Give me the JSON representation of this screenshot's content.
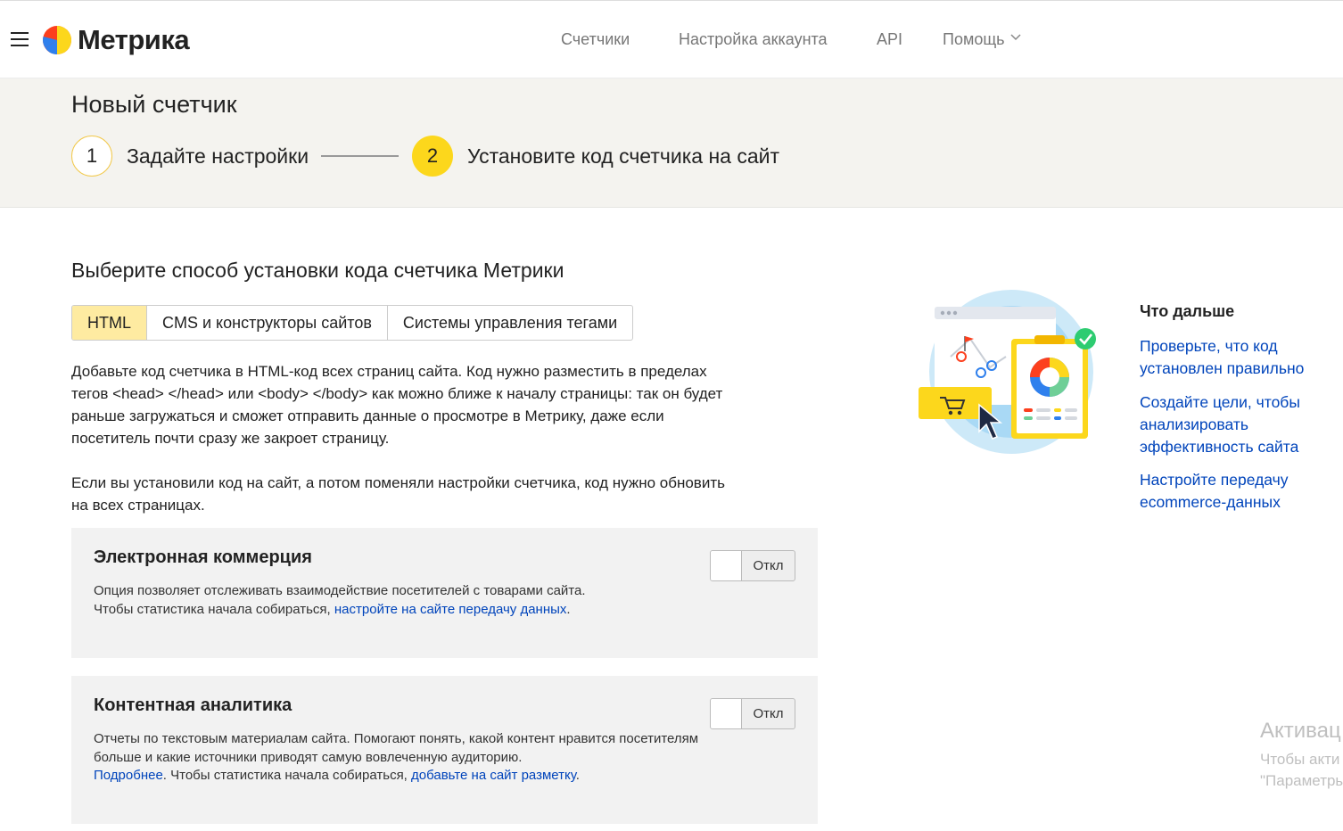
{
  "header": {
    "logo_text": "Метрика",
    "nav": [
      {
        "label": "Счетчики"
      },
      {
        "label": "Настройка аккаунта"
      },
      {
        "label": "API"
      },
      {
        "label": "Помощь"
      }
    ]
  },
  "wizard": {
    "title": "Новый счетчик",
    "steps": [
      {
        "number": "1",
        "label": "Задайте настройки"
      },
      {
        "number": "2",
        "label": "Установите код счетчика на сайт"
      }
    ]
  },
  "install": {
    "title": "Выберите способ установки кода счетчика Метрики",
    "tabs": [
      {
        "label": "HTML",
        "active": true
      },
      {
        "label": "CMS и конструкторы сайтов",
        "active": false
      },
      {
        "label": "Системы управления тегами",
        "active": false
      }
    ],
    "paragraph1": "Добавьте код счетчика в HTML-код всех страниц сайта. Код нужно разместить в пределах тегов <head> </head> или <body> </body> как можно ближе к началу страницы: так он будет раньше загружаться и сможет отправить данные о просмотре в Метрику, даже если посетитель почти сразу же закроет страницу.",
    "paragraph2": "Если вы установили код на сайт, а потом поменяли настройки счетчика, код нужно обновить на всех страницах."
  },
  "ecommerce": {
    "title": "Электронная коммерция",
    "text1": "Опция позволяет отслеживать взаимодействие посетителей с товарами сайта.",
    "text2": "Чтобы статистика начала собираться, ",
    "link": "настройте на сайте передачу данных",
    "text3": ".",
    "toggle": "Откл"
  },
  "content_analytics": {
    "title": "Контентная аналитика",
    "text1": "Отчеты по текстовым материалам сайта. Помогают понять, какой контент нравится посетителям больше и какие источники приводят самую вовлеченную аудиторию.",
    "link1": "Подробнее",
    "text2": ". Чтобы статистика начала собираться, ",
    "link2": "добавьте на сайт разметку",
    "text3": ".",
    "toggle": "Откл"
  },
  "next": {
    "title": "Что дальше",
    "links": [
      {
        "label": "Проверьте, что код установлен правильно"
      },
      {
        "label": "Создайте цели, чтобы анализировать эффективность сайта"
      },
      {
        "label": "Настройте передачу ecommerce-данных"
      }
    ]
  },
  "watermark": {
    "line1": "Активац",
    "line2": "Чтобы акти",
    "line3": "\"Параметры"
  },
  "colors": {
    "accent_yellow": "#fcd71c",
    "active_tab": "#feeba1",
    "link_blue": "#0044bb",
    "stepbar_bg": "#f4f3ef",
    "card_bg": "#f2f2f2"
  }
}
